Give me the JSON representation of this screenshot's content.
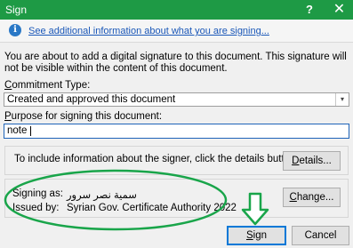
{
  "window": {
    "title": "Sign",
    "help_label": "?",
    "close_label": "✕"
  },
  "infobar": {
    "icon": "info-icon",
    "icon_glyph": "i",
    "link": "See additional information about what you are signing..."
  },
  "intro": "You are about to add a digital signature to this document. This signature will not be visible within the content of this document.",
  "commitment": {
    "label_accel": "C",
    "label_rest": "ommitment Type:",
    "selected": "Created and approved this document",
    "arrow_glyph": "▾"
  },
  "purpose": {
    "label_accel": "P",
    "label_rest": "urpose for signing this document:",
    "value": "note"
  },
  "details": {
    "text": "To include information about the signer, click the details button.",
    "button_accel": "D",
    "button_rest": "etails..."
  },
  "signer": {
    "signing_as_label": "Signing as:",
    "signing_as_value": "سمية نصر سرور",
    "issued_by_label": "Issued by:",
    "issued_by_value": "Syrian Gov. Certificate Authority 2022",
    "change_accel": "C",
    "change_rest": "hange..."
  },
  "buttons": {
    "sign_accel": "S",
    "sign_rest": "ign",
    "cancel": "Cancel"
  },
  "colors": {
    "titlebar": "#1e9a45",
    "annotation": "#19a54a",
    "link": "#1a57b8",
    "focus": "#0078d7"
  }
}
